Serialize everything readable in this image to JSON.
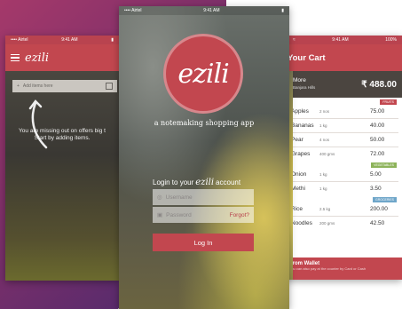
{
  "colors": {
    "brand": "#c2474f",
    "dark_overlay": "#4b4540"
  },
  "left_phone": {
    "status": {
      "carrier": "•••• Airtel",
      "time": "9:41 AM"
    },
    "brand": "ezili",
    "add_items_placeholder": "Add items here",
    "empty_message_1": "You are missing out on offers big t",
    "empty_message_2": "Start by adding items.",
    "icons": [
      "menu-icon",
      "plus-icon",
      "grid-icon",
      "arrow-icon"
    ]
  },
  "center_phone": {
    "status": {
      "carrier": "•••• Airtel",
      "time": "9:41 AM"
    },
    "brand": "ezili",
    "tagline": "a notemaking shopping app",
    "login_prefix": "Login to your",
    "login_brand": "ezili",
    "login_suffix": "account",
    "username_placeholder": "Username",
    "password_placeholder": "Password",
    "forgot_label": "Forgot?",
    "login_button": "Log In"
  },
  "right_phone": {
    "status": {
      "time": "9:41 AM",
      "battery": "100%"
    },
    "title": "Your Cart",
    "store": {
      "name": "More",
      "sub": "Banjara Hills"
    },
    "total": "₹ 488.00",
    "sections": [
      {
        "tag": "FRUITS",
        "tag_color": "#c2474f",
        "items": [
          {
            "name": "Apples",
            "qty": "2 nos",
            "price": "75.00"
          },
          {
            "name": "Bananas",
            "qty": "1 kg",
            "price": "40.00"
          },
          {
            "name": "Pear",
            "qty": "4 nos",
            "price": "50.00"
          },
          {
            "name": "Grapes",
            "qty": "400 gms",
            "price": "72.00"
          }
        ]
      },
      {
        "tag": "VEGETABLES",
        "tag_color": "#8db35a",
        "items": [
          {
            "name": "Onion",
            "qty": "1 kg",
            "price": "5.00"
          },
          {
            "name": "Methi",
            "qty": "1 kg",
            "price": "3.50"
          }
        ]
      },
      {
        "tag": "GROCERIES",
        "tag_color": "#6fa6c9",
        "items": [
          {
            "name": "Rice",
            "qty": "2.5 kg",
            "price": "200.00"
          },
          {
            "name": "Noodles",
            "qty": "200 gms",
            "price": "42.50"
          }
        ]
      }
    ],
    "wallet_title": "From Wallet",
    "wallet_sub": "You can also pay at the counter by Card or Cash"
  }
}
